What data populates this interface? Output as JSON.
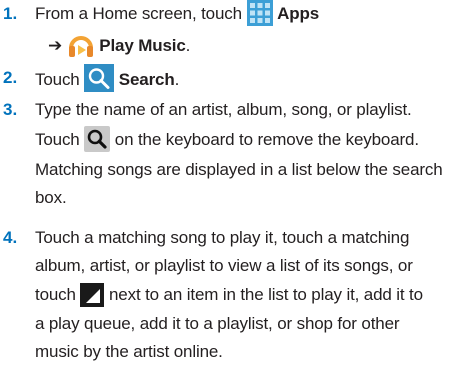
{
  "steps": [
    {
      "number": "1.",
      "line1_text": "From a Home screen, touch",
      "apps_icon": "apps-grid-icon",
      "apps_label": "Apps",
      "arrow": "➔",
      "music_icon": "play-music-headphones-icon",
      "music_label": "Play Music",
      "end": "."
    },
    {
      "number": "2.",
      "text": "Touch",
      "search_icon": "search-icon",
      "search_label": "Search",
      "end": "."
    },
    {
      "number": "3.",
      "lines": [
        "Type the name of an artist, album, song, or playlist.",
        "on the keyboard to remove the keyboard.",
        "Matching songs are displayed in a list below the search",
        "box."
      ],
      "touch_word": "Touch",
      "keyboard_icon": "keyboard-search-icon"
    },
    {
      "number": "4.",
      "lines": [
        "Touch a matching song to play it, touch a matching",
        "album, artist, or playlist to view a list of its songs, or",
        "next to an item in the list to play it, add it to",
        "a play queue, add it to a playlist, or shop for other",
        "music by the artist online."
      ],
      "touch_word": "touch",
      "menu_icon": "context-menu-icon"
    }
  ],
  "colors": {
    "number": "#0072bc",
    "text": "#231f20",
    "apps_icon": "#3c9fd6",
    "search_icon_bg": "#2f8dc4",
    "headphones_orange": "#f3a334"
  }
}
